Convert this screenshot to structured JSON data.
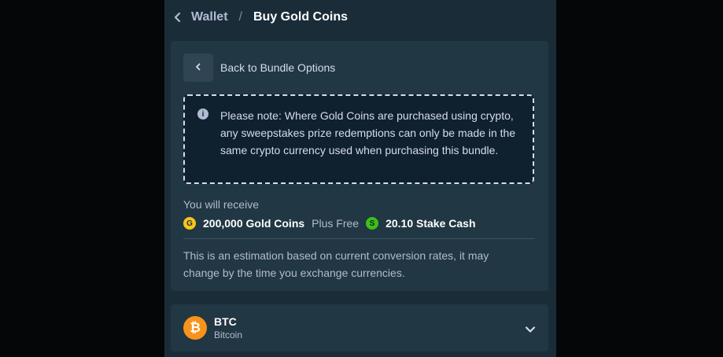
{
  "header": {
    "crumb": "Wallet",
    "separator": "/",
    "current": "Buy Gold Coins"
  },
  "back": {
    "label": "Back to Bundle Options"
  },
  "notice": {
    "icon": "info-icon",
    "icon_glyph": "i",
    "text": "Please note: Where Gold Coins are purchased using crypto, any sweepstakes prize redemptions can only be made in the same crypto currency used when purchasing this bundle."
  },
  "receive": {
    "label": "You will receive",
    "gold_glyph": "G",
    "gold_amount": "200,000 Gold Coins",
    "plus_label": "Plus Free",
    "cash_glyph": "S",
    "cash_amount": "20.10 Stake Cash"
  },
  "estimate": {
    "text": "This is an estimation based on current conversion rates, it may change by the time you exchange currencies."
  },
  "currency": {
    "code": "BTC",
    "name": "Bitcoin",
    "glyph": "₿"
  },
  "colors": {
    "background": "#050607",
    "modal": "#1a2c38",
    "panel": "#213743",
    "notice": "#0f212e",
    "gold_coin": "#f5c518",
    "stake_cash": "#3bc117",
    "bitcoin": "#f7931a"
  }
}
